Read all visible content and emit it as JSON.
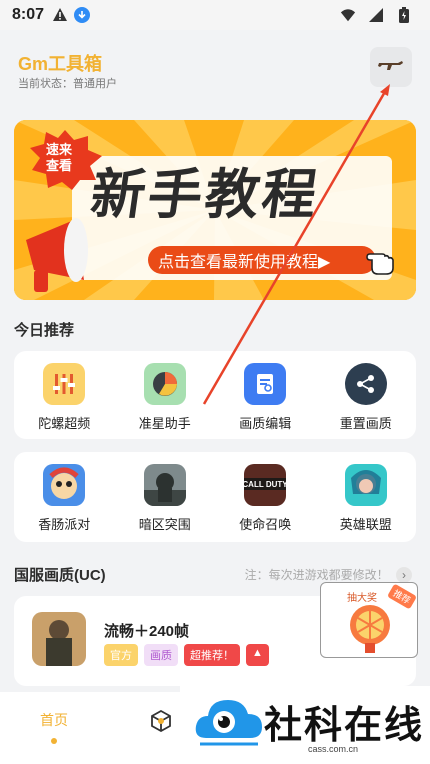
{
  "status_bar": {
    "time": "8:07"
  },
  "header": {
    "title": "Gm工具箱",
    "status": "当前状态：普通用户"
  },
  "banner": {
    "badge": "速来\n查看",
    "title": "新手教程",
    "subtitle": "点击查看最新使用教程▶"
  },
  "today": {
    "title": "今日推荐",
    "tools": [
      {
        "label": "陀螺超频",
        "icon": "sliders-icon",
        "color": "#fbd36b"
      },
      {
        "label": "准星助手",
        "icon": "pie-chart-icon",
        "color": "#a7dfb0"
      },
      {
        "label": "画质编辑",
        "icon": "document-edit-icon",
        "color": "#3e7cf2"
      },
      {
        "label": "重置画质",
        "icon": "share-icon",
        "color": "#2d3e50"
      }
    ],
    "games": [
      {
        "label": "香肠派对",
        "icon": "sausage-party-icon"
      },
      {
        "label": "暗区突围",
        "icon": "arena-breakout-icon"
      },
      {
        "label": "使命召唤",
        "icon": "call-of-duty-icon"
      },
      {
        "label": "英雄联盟",
        "icon": "league-of-legends-icon"
      }
    ]
  },
  "quality": {
    "title": "国服画质(UC)",
    "note": "注：每次进游戏都要修改！"
  },
  "product": {
    "name": "流畅＋240帧",
    "tags": [
      "官方",
      "画质",
      "超推荐！"
    ]
  },
  "promo": {
    "label": "抽大奖",
    "tag": "推荐"
  },
  "tabbar": {
    "home": "首页"
  },
  "watermark": {
    "title": "社科在线",
    "site": "cass.com.cn"
  }
}
